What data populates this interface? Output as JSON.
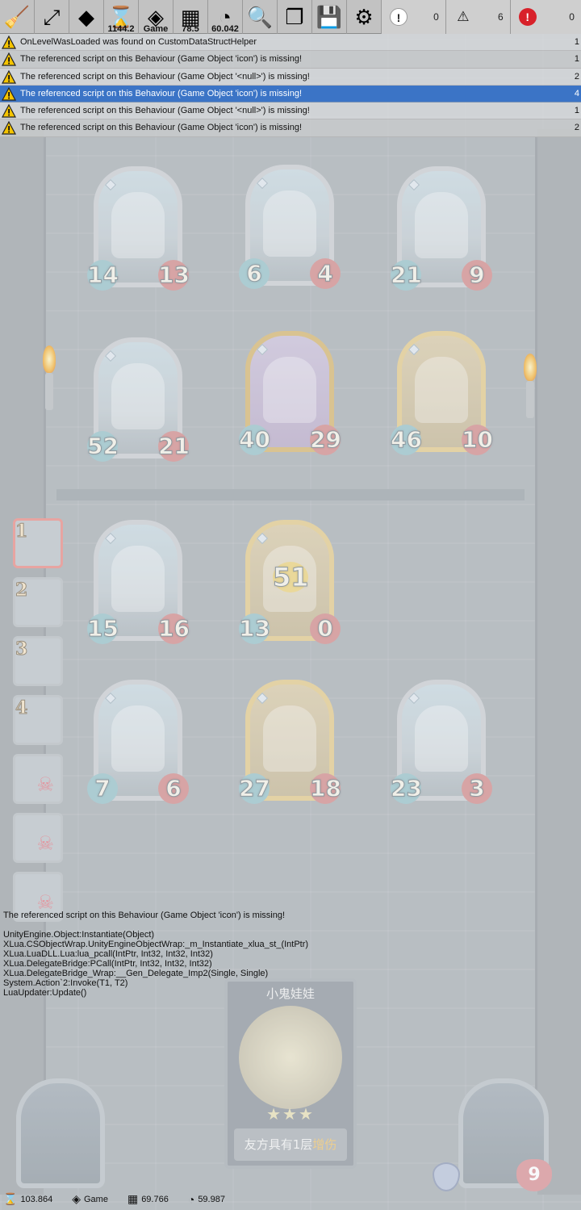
{
  "toolbar": {
    "buttons": [
      {
        "icon": "broom-icon",
        "glyph": "🧹",
        "caption": ""
      },
      {
        "icon": "expand-icon",
        "glyph": "⤢",
        "caption": ""
      },
      {
        "icon": "unity-logo-icon",
        "glyph": "◆",
        "caption": ""
      },
      {
        "icon": "hourglass-icon",
        "glyph": "⌛",
        "caption": "1144.2"
      },
      {
        "icon": "unity-game-icon",
        "glyph": "◈",
        "caption": "Game"
      },
      {
        "icon": "memory-icon",
        "glyph": "▦",
        "caption": "78.5"
      },
      {
        "icon": "speedometer-icon",
        "glyph": "◔",
        "caption": "60.042"
      },
      {
        "icon": "search-icon",
        "glyph": "🔍",
        "caption": ""
      },
      {
        "icon": "copy-icon",
        "glyph": "❐",
        "caption": ""
      },
      {
        "icon": "save-icon",
        "glyph": "💾",
        "caption": ""
      },
      {
        "icon": "settings-info-icon",
        "glyph": "⚙",
        "caption": ""
      }
    ],
    "counters": {
      "info": "0",
      "warning": "6",
      "error": "0"
    }
  },
  "log": {
    "rows": [
      {
        "text": "OnLevelWasLoaded was found on CustomDataStructHelper",
        "count": "1"
      },
      {
        "text": "The referenced script on this Behaviour (Game Object 'icon') is missing!",
        "count": "1"
      },
      {
        "text": "The referenced script on this Behaviour (Game Object '<null>') is missing!",
        "count": "2"
      },
      {
        "text": "The referenced script on this Behaviour (Game Object 'icon') is missing!",
        "count": "4"
      },
      {
        "text": "The referenced script on this Behaviour (Game Object '<null>') is missing!",
        "count": "1"
      },
      {
        "text": "The referenced script on this Behaviour (Game Object 'icon') is missing!",
        "count": "2"
      }
    ],
    "selected_index": 3
  },
  "detail": {
    "message": "The referenced script on this Behaviour (Game Object 'icon') is missing!",
    "trace": "UnityEngine.Object:Instantiate(Object)\nXLua.CSObjectWrap.UnityEngineObjectWrap:_m_Instantiate_xlua_st_(IntPtr)\nXLua.LuaDLL.Lua:lua_pcall(IntPtr, Int32, Int32, Int32)\nXLua.DelegateBridge:PCall(IntPtr, Int32, Int32, Int32)\nXLua.DelegateBridge_Wrap:__Gen_Delegate_Imp2(Single, Single)\nSystem.Action`2:Invoke(T1, T2)\nLuaUpdater:Update()"
  },
  "enemy_cards": [
    {
      "atk": "14",
      "hp": "13",
      "style": "plain"
    },
    {
      "atk": "6",
      "hp": "4",
      "style": "plain"
    },
    {
      "atk": "21",
      "hp": "9",
      "style": "plain"
    },
    {
      "atk": "52",
      "hp": "21",
      "style": "plain"
    },
    {
      "atk": "40",
      "hp": "29",
      "style": "purple"
    },
    {
      "atk": "46",
      "hp": "10",
      "style": "gold"
    }
  ],
  "player_cards": [
    {
      "atk": "15",
      "hp": "16",
      "style": "plain"
    },
    {
      "atk": "13",
      "hp": "0",
      "style": "gold",
      "center": "51"
    },
    {
      "atk": "7",
      "hp": "6",
      "style": "plain"
    },
    {
      "atk": "27",
      "hp": "18",
      "style": "gold"
    },
    {
      "atk": "23",
      "hp": "3",
      "style": "plain"
    }
  ],
  "queue": [
    {
      "num": "1",
      "dead": false
    },
    {
      "num": "2",
      "dead": false
    },
    {
      "num": "3",
      "dead": false
    },
    {
      "num": "4",
      "dead": false
    },
    {
      "num": "",
      "dead": true
    },
    {
      "num": "",
      "dead": true
    },
    {
      "num": "",
      "dead": true
    }
  ],
  "preview": {
    "title": "小鬼娃娃",
    "stars": "★★★",
    "desc_prefix": "友方具有1层",
    "desc_keyword": "增伤"
  },
  "hero": {
    "hp": "9"
  },
  "statusbar": {
    "items": [
      {
        "icon": "hourglass-icon",
        "glyph": "⌛",
        "value": "103.864"
      },
      {
        "icon": "unity-game-icon",
        "glyph": "◈",
        "value": "Game"
      },
      {
        "icon": "memory-icon",
        "glyph": "▦",
        "value": "69.766"
      },
      {
        "icon": "speedometer-icon",
        "glyph": "◔",
        "value": "59.987"
      }
    ]
  }
}
